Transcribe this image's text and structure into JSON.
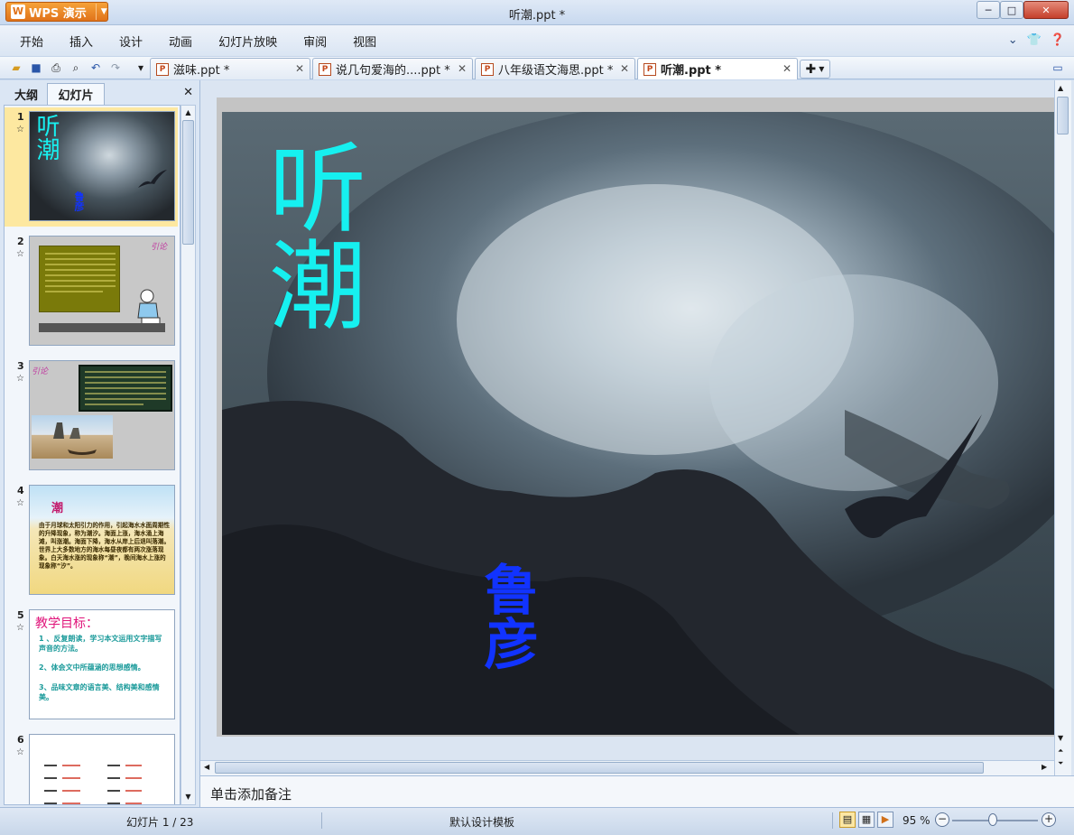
{
  "app": {
    "brand": "WPS 演示",
    "window_title": "听潮.ppt *"
  },
  "window_controls": {
    "minimize": "─",
    "maximize": "□",
    "close": "✕"
  },
  "menu": [
    "开始",
    "插入",
    "设计",
    "动画",
    "幻灯片放映",
    "审阅",
    "视图"
  ],
  "doc_tabs": [
    {
      "label": "滋味.ppt *"
    },
    {
      "label": "说几句爱海的....ppt *"
    },
    {
      "label": "八年级语文海思.ppt *"
    },
    {
      "label": "听潮.ppt *"
    }
  ],
  "left_pane": {
    "tabs": [
      "大纲",
      "幻灯片"
    ],
    "thumbnails": [
      {
        "num": "1",
        "title": "听潮",
        "author": "鲁彦"
      },
      {
        "num": "2",
        "tag": "引论"
      },
      {
        "num": "3",
        "tag": "引论"
      },
      {
        "num": "4",
        "title": "潮",
        "text": "由于月球和太阳引力的作用，引起海水水面周期性的升降现象，称为潮汐。海面上涨，海水涌上海滩，叫涨潮。海面下降，海水从岸上后退叫落潮。世界上大多数地方的海水每昼夜都有两次涨落现象。白天海水涨的现象称“潮”，晚间海水上涨的现象称“汐”。"
      },
      {
        "num": "5",
        "title": "教学目标：",
        "items": [
          "1 、反复朗读，学习本文运用文字描写声音的方法。",
          "2、体会文中所蕴涵的思想感情。",
          "3、品味文章的语言美、结构美和感情美。"
        ]
      },
      {
        "num": "6"
      }
    ]
  },
  "slide": {
    "title": "听潮",
    "author": "鲁彦"
  },
  "notes_placeholder": "单击添加备注",
  "status": {
    "slide_counter": "幻灯片 1 / 23",
    "template": "默认设计模板",
    "zoom": "95 %"
  }
}
